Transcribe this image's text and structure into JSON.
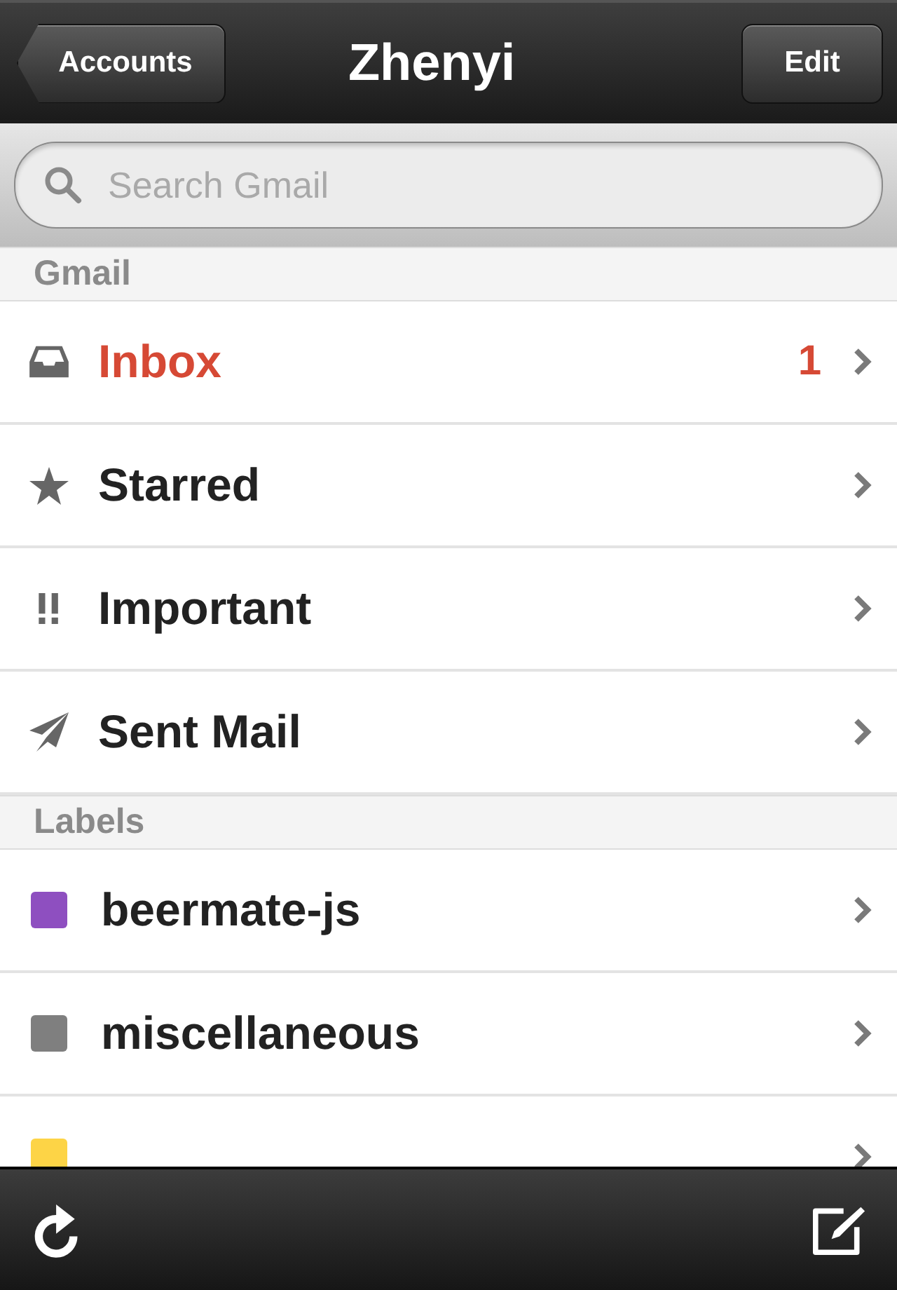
{
  "nav_bar": {
    "back_button": "Accounts",
    "title": "Zhenyi",
    "edit_button": "Edit"
  },
  "search": {
    "placeholder": "Search Gmail"
  },
  "sections": [
    {
      "title": "Gmail",
      "items": [
        {
          "kind": "folder",
          "label": "Inbox",
          "unread": true,
          "count": "1"
        },
        {
          "kind": "folder",
          "label": "Starred",
          "unread": false
        },
        {
          "kind": "folder",
          "label": "Important",
          "unread": false
        },
        {
          "kind": "folder",
          "label": "Sent Mail",
          "unread": false
        }
      ]
    },
    {
      "title": "Labels",
      "items": [
        {
          "kind": "label",
          "color": "#8e4fc0",
          "label": "beermate-js",
          "unread": false
        },
        {
          "kind": "label",
          "color": "#7f7f7f",
          "label": "miscellaneous",
          "unread": false
        },
        {
          "kind": "label",
          "color": "#fdd446"
        }
      ]
    }
  ]
}
